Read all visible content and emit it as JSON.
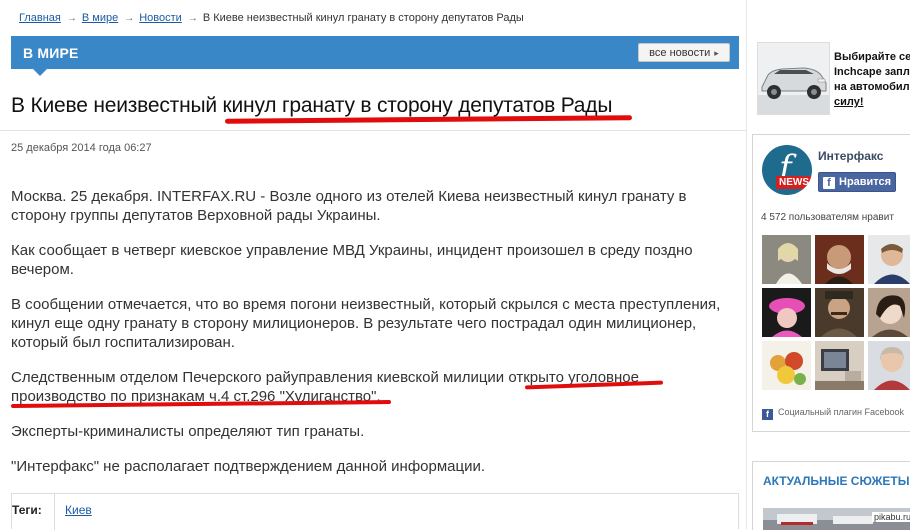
{
  "breadcrumb": {
    "items": [
      "Главная",
      "В мире",
      "Новости"
    ],
    "current": "В Киеве неизвестный кинул гранату в сторону депутатов Рады"
  },
  "section": {
    "title": "В МИРЕ",
    "all_news_label": "все новости"
  },
  "article": {
    "headline_before": "В Киеве неизвестный ",
    "headline_marked": "кинул гранату в сторону депутатов Рады",
    "date": "25 декабря 2014 года 06:27",
    "paragraphs": [
      "Москва. 25 декабря. INTERFAX.RU - Возле одного из отелей Киева неизвестный кинул гранату в сторону группы депутатов Верховной рады Украины.",
      "Как сообщает в четверг киевское управление МВД Украины, инцидент произошел в среду поздно вечером.",
      "В сообщении отмечается, что во время погони неизвестный, который скрылся с места преступления, кинул еще одну гранату в сторону милиционеров. В результате чего пострадал один милиционер, который был госпитализирован.",
      "Следственным отделом Печерского райуправления киевской милиции открыто уголовное производство по признакам ч.4 ст.296 \"Хулиганство\".",
      "Эксперты-криминалисты определяют тип гранаты.",
      "\"Интерфакс\" не располагает подтверждением данной информации."
    ],
    "tags_label": "Теги:",
    "tags": [
      "Киев"
    ]
  },
  "sidebar": {
    "ad": {
      "line1": "Выбирайте се",
      "line2": "Inchcape запл",
      "line3": "на автомобил",
      "line4": "силу!"
    },
    "fb_box": {
      "page_name": "Интерфакс",
      "logo_badge": "NEWS",
      "like_label": "Нравится",
      "count_text": "4 572 пользователям нравит",
      "plugin_text": "Социальный плагин Facebook"
    },
    "topics": {
      "title": "АКТУАЛЬНЫЕ СЮЖЕТЫ"
    }
  },
  "watermark": "pikabu.ru",
  "colors": {
    "section_blue": "#3a87c8",
    "link": "#1b5ba6",
    "marker_red": "#e10c0c",
    "fb_blue": "#4a66a0"
  }
}
